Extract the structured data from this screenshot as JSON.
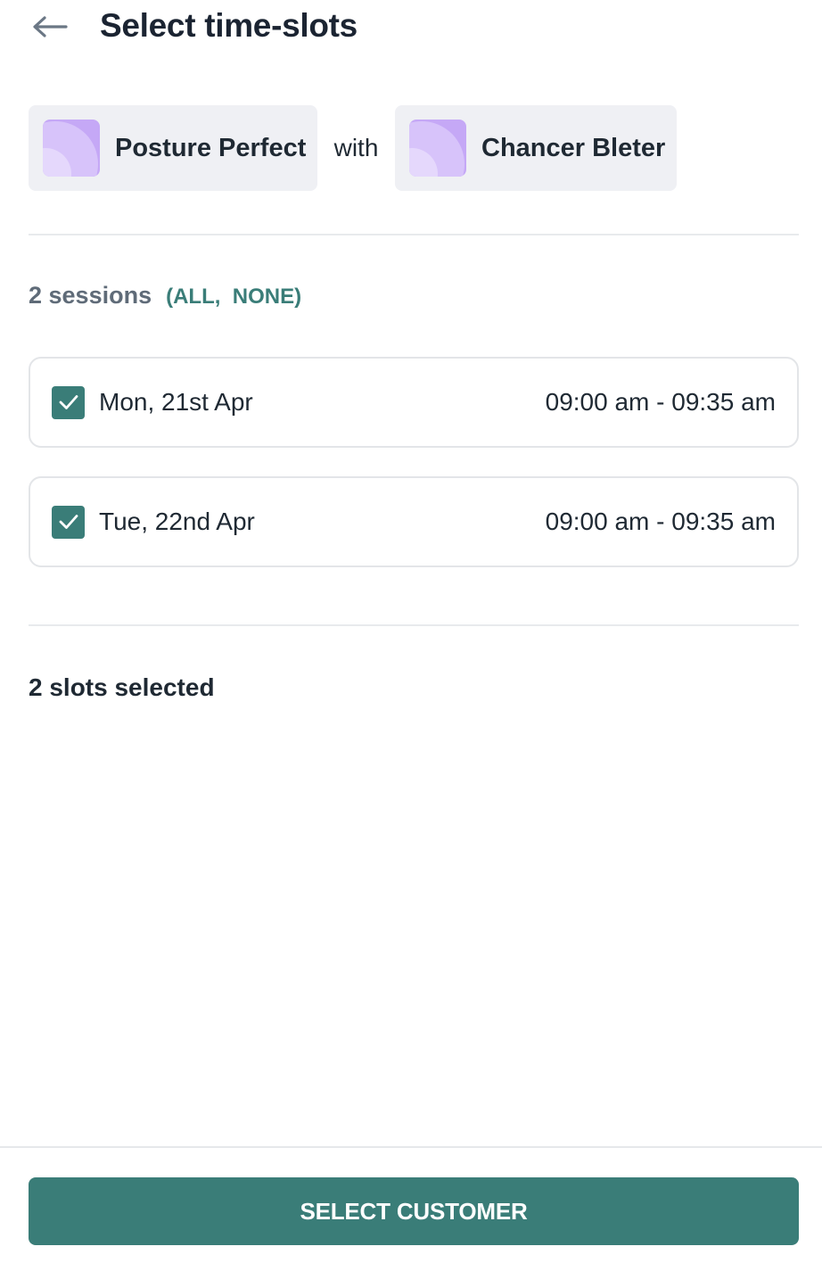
{
  "header": {
    "title": "Select time-slots",
    "back_icon": "arrow-left-icon"
  },
  "booking": {
    "service_name": "Posture Perfect",
    "connector": "with",
    "staff_name": "Chancer Bleter",
    "thumbnail_color": "#c5a8f6"
  },
  "sessions": {
    "count_label": "2 sessions",
    "open_paren": "(",
    "all_label": "ALL",
    "separator": ",",
    "none_label": "NONE",
    "close_paren": ")",
    "slots": [
      {
        "date": "Mon, 21st Apr",
        "time": "09:00 am - 09:35 am",
        "checked": true
      },
      {
        "date": "Tue, 22nd Apr",
        "time": "09:00 am - 09:35 am",
        "checked": true
      }
    ]
  },
  "summary": {
    "selected_label": "2 slots selected"
  },
  "footer": {
    "primary_button_label": "SELECT CUSTOMER"
  },
  "colors": {
    "accent": "#3a7d78",
    "chip_bg": "#eff0f4",
    "title": "#1b2432"
  }
}
